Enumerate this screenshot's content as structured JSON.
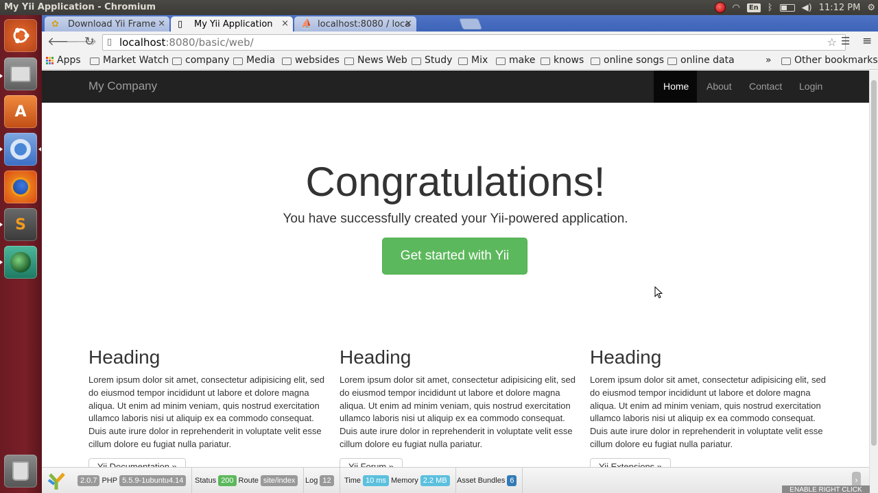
{
  "os": {
    "window_title": "My Yii Application - Chromium",
    "lang": "En",
    "time": "11:12 PM"
  },
  "browser": {
    "tabs": [
      {
        "title": "Download Yii Frame",
        "active": false
      },
      {
        "title": "My Yii Application",
        "active": true
      },
      {
        "title": "localhost:8080 / loca",
        "active": false
      }
    ],
    "url_host": "localhost",
    "url_rest": ":8080/basic/web/",
    "bookmarks": [
      "Apps",
      "Market Watch",
      "company",
      "Media",
      "websides",
      "News Web",
      "Study",
      "Mix",
      "make",
      "knows",
      "online songs",
      "online data"
    ],
    "overflow": "»",
    "other_bookmarks": "Other bookmarks"
  },
  "site": {
    "brand": "My Company",
    "nav": [
      "Home",
      "About",
      "Contact",
      "Login"
    ],
    "active_nav": "Home",
    "hero_title": "Congratulations!",
    "hero_lead": "You have successfully created your Yii-powered application.",
    "cta_label": "Get started with Yii",
    "columns": [
      {
        "heading": "Heading",
        "body": "Lorem ipsum dolor sit amet, consectetur adipisicing elit, sed do eiusmod tempor incididunt ut labore et dolore magna aliqua. Ut enim ad minim veniam, quis nostrud exercitation ullamco laboris nisi ut aliquip ex ea commodo consequat. Duis aute irure dolor in reprehenderit in voluptate velit esse cillum dolore eu fugiat nulla pariatur.",
        "button": "Yii Documentation »"
      },
      {
        "heading": "Heading",
        "body": "Lorem ipsum dolor sit amet, consectetur adipisicing elit, sed do eiusmod tempor incididunt ut labore et dolore magna aliqua. Ut enim ad minim veniam, quis nostrud exercitation ullamco laboris nisi ut aliquip ex ea commodo consequat. Duis aute irure dolor in reprehenderit in voluptate velit esse cillum dolore eu fugiat nulla pariatur.",
        "button": "Yii Forum »"
      },
      {
        "heading": "Heading",
        "body": "Lorem ipsum dolor sit amet, consectetur adipisicing elit, sed do eiusmod tempor incididunt ut labore et dolore magna aliqua. Ut enim ad minim veniam, quis nostrud exercitation ullamco laboris nisi ut aliquip ex ea commodo consequat. Duis aute irure dolor in reprehenderit in voluptate velit esse cillum dolore eu fugiat nulla pariatur.",
        "button": "Yii Extensions »"
      }
    ]
  },
  "debug": {
    "yii_version": "2.0.7",
    "php_label": "PHP",
    "php_version": "5.5.9-1ubuntu4.14",
    "status_label": "Status",
    "status": "200",
    "route_label": "Route",
    "route": "site/index",
    "log_label": "Log",
    "log": "12",
    "time_label": "Time",
    "time": "10 ms",
    "memory_label": "Memory",
    "memory": "2.2 MB",
    "assets_label": "Asset Bundles",
    "assets": "6"
  },
  "overlay": {
    "right_click": "ENABLE RIGHT CLICK"
  },
  "colors": {
    "success": "#5cb85c",
    "navbar": "#222222",
    "launcher": "#7a1f28",
    "tabstrip": "#4f73c4"
  }
}
